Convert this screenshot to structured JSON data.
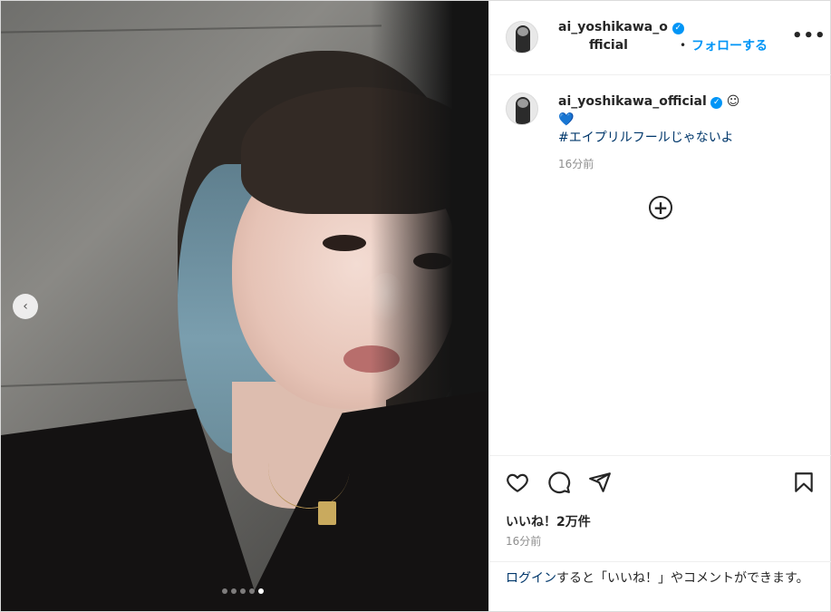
{
  "post": {
    "username": "ai_yoshikawa_official",
    "header_username_line1": "ai_yoshikawa_o",
    "header_username_line2": "fficial",
    "follow_label": "フォローする",
    "more_label": "•••",
    "bullet": "•",
    "verified_glyph": "✓"
  },
  "caption": {
    "username": "ai_yoshikawa_official",
    "emoji": "☺",
    "heart": "💙",
    "hashtag": "#エイプリルフールじゃないよ",
    "time": "16分前",
    "load_more": "+"
  },
  "actions": {
    "likes": "いいね！2万件",
    "posted": "16分前",
    "icons": [
      "heart-icon",
      "comment-icon",
      "share-icon",
      "bookmark-icon"
    ]
  },
  "login": {
    "link": "ログイン",
    "rest": "すると「いいね！」やコメントができます。"
  },
  "carousel": {
    "prev_label": "‹",
    "slide_count": 5,
    "active_slide": 5
  },
  "colors": {
    "accent": "#0095f6",
    "link": "#00376b",
    "muted": "#8e8e8e",
    "border": "#dbdbdb"
  }
}
